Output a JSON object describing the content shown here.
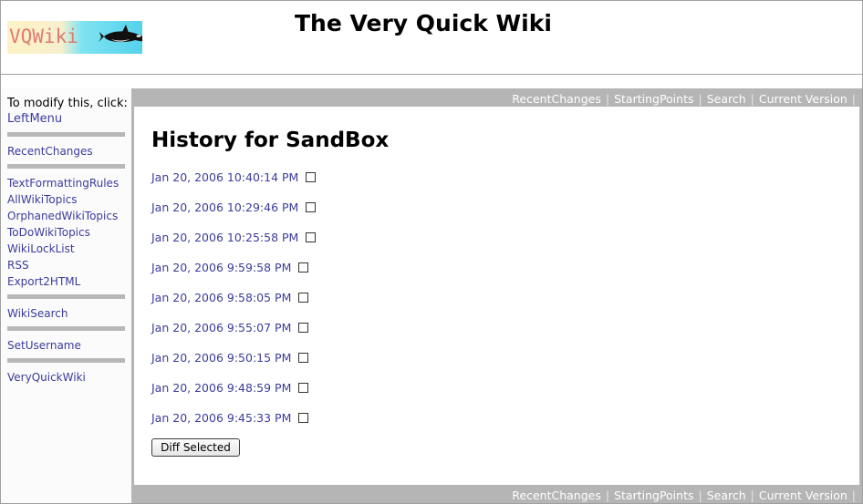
{
  "header": {
    "logo_text": "VQWiki",
    "site_title": "The Very Quick Wiki"
  },
  "left_menu": {
    "modify_text": "To modify this, click:",
    "modify_link": "LeftMenu",
    "groups": [
      [
        "RecentChanges"
      ],
      [
        "TextFormattingRules",
        "AllWikiTopics",
        "OrphanedWikiTopics",
        "ToDoWikiTopics",
        "WikiLockList",
        "RSS",
        "Export2HTML"
      ],
      [
        "WikiSearch"
      ],
      [
        "SetUsername"
      ],
      [
        "VeryQuickWiki"
      ]
    ]
  },
  "nav": {
    "items": [
      "RecentChanges",
      "StartingPoints",
      "Search",
      "Current Version"
    ],
    "separator": "|"
  },
  "main": {
    "title": "History for SandBox",
    "history": [
      "Jan 20, 2006 10:40:14 PM",
      "Jan 20, 2006 10:29:46 PM",
      "Jan 20, 2006 10:25:58 PM",
      "Jan 20, 2006 9:59:58 PM",
      "Jan 20, 2006 9:58:05 PM",
      "Jan 20, 2006 9:55:07 PM",
      "Jan 20, 2006 9:50:15 PM",
      "Jan 20, 2006 9:48:59 PM",
      "Jan 20, 2006 9:45:33 PM"
    ],
    "diff_button_label": "Diff Selected"
  },
  "colors": {
    "link": "#3c3c9c",
    "nav_bar": "#b5b5b5",
    "menu_divider": "#b8b8b8"
  }
}
